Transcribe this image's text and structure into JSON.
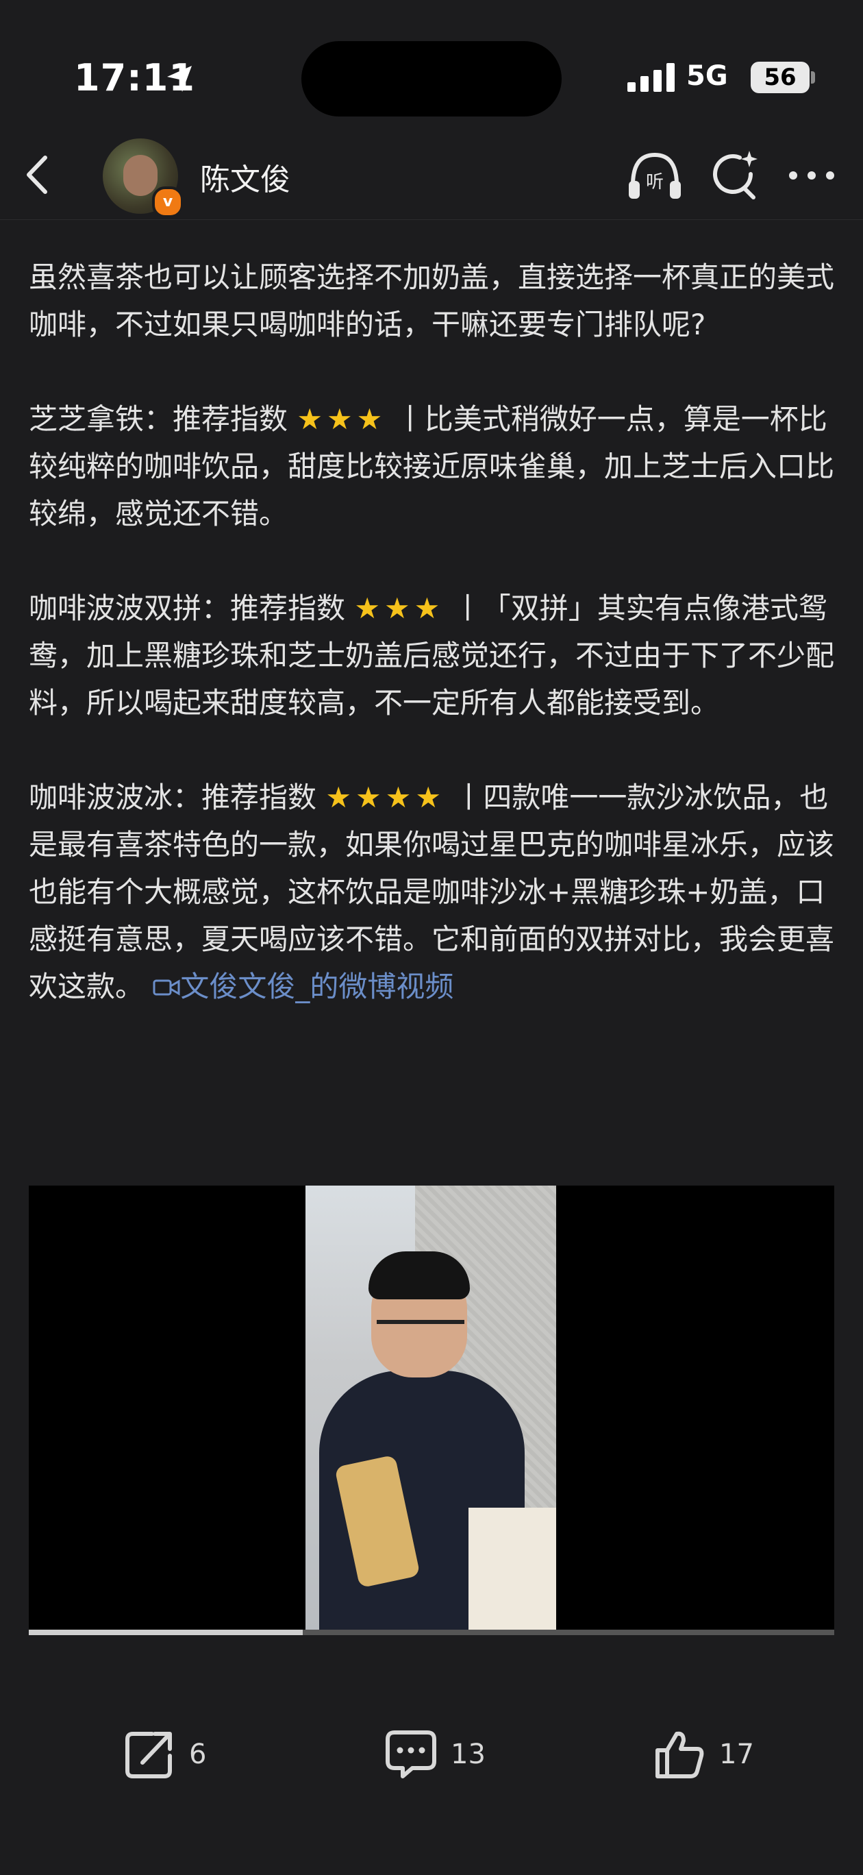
{
  "status_bar": {
    "time": "17:11",
    "network": "5G",
    "battery": "56"
  },
  "header": {
    "back_icon": "chevron-left-icon",
    "username": "陈文俊",
    "verified_badge": "v",
    "icons": [
      "headphones-listen-icon",
      "share-sparkle-icon",
      "more-dots-icon"
    ]
  },
  "article": {
    "p1": "虽然喜茶也可以让顾客选择不加奶盖，直接选择一杯真正的美式咖啡，不过如果只喝咖啡的话，干嘛还要专门排队呢?",
    "p2_title": "芝芝拿铁：推荐指数",
    "p2_stars": "★★★",
    "p2_body": "丨比美式稍微好一点，算是一杯比较纯粹的咖啡饮品，甜度比较接近原味雀巢，加上芝士后入口比较绵，感觉还不错。",
    "p3_title": "咖啡波波双拼：推荐指数",
    "p3_stars": "★★★",
    "p3_body": "丨「双拼」其实有点像港式鸳鸯，加上黑糖珍珠和芝士奶盖后感觉还行，不过由于下了不少配料，所以喝起来甜度较高，不一定所有人都能接受到。",
    "p4_title": "咖啡波波冰：推荐指数",
    "p4_stars": "★★★★",
    "p4_body": "丨四款唯一一款沙冰饮品，也是最有喜茶特色的一款，如果你喝过星巴克的咖啡星冰乐，应该也能有个大概感觉，这杯饮品是咖啡沙冰+黑糖珍珠+奶盖，口感挺有意思，夏天喝应该不错。它和前面的双拼对比，我会更喜欢这款。",
    "video_link": "文俊文俊_的微博视频"
  },
  "video": {
    "progress": 0.34
  },
  "footer": {
    "repost_count": "6",
    "comment_count": "13",
    "like_count": "17"
  },
  "colors": {
    "background": "#1c1c1e",
    "link": "#6b8ec9",
    "star": "#f6c21b",
    "badge": "#f07a13"
  }
}
